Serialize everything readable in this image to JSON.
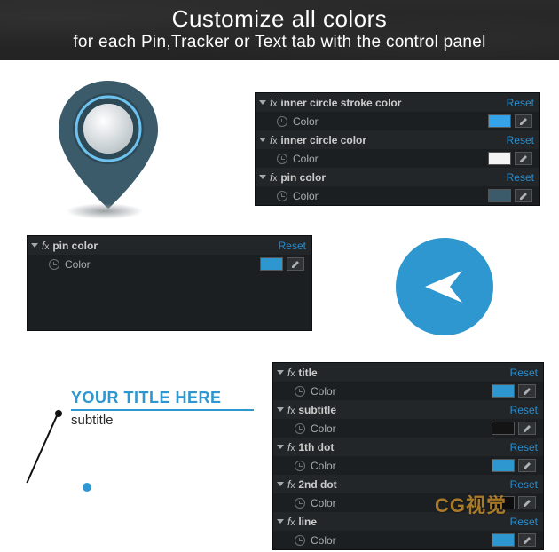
{
  "hero": {
    "title": "Customize all colors",
    "subtitle": "for each Pin,Tracker or Text tab with the control panel"
  },
  "reset_label": "Reset",
  "color_prop_label": "Color",
  "panel_pin": {
    "effects": [
      {
        "name": "inner circle stroke color",
        "swatch": "#35a3ea"
      },
      {
        "name": "inner circle color",
        "swatch": "#f4f4f4"
      },
      {
        "name": "pin color",
        "swatch": "#3b5a6a"
      }
    ]
  },
  "panel_single": {
    "effects": [
      {
        "name": "pin color",
        "swatch": "#2f97cf"
      }
    ]
  },
  "panel_title": {
    "effects": [
      {
        "name": "title",
        "swatch": "#2f97cf"
      },
      {
        "name": "subtitle",
        "swatch": "#141414"
      },
      {
        "name": "1th dot",
        "swatch": "#2f97cf"
      },
      {
        "name": "2nd dot",
        "swatch": "#0e0e0e"
      },
      {
        "name": "line",
        "swatch": "#2f97cf"
      }
    ]
  },
  "title_graphic": {
    "main": "YOUR TITLE HERE",
    "sub": "subtitle"
  },
  "colors": {
    "accent": "#2f97cf",
    "pin_body": "#3b5a6a",
    "pin_inner": "#f4f4f4"
  },
  "watermark": "CG视觉"
}
